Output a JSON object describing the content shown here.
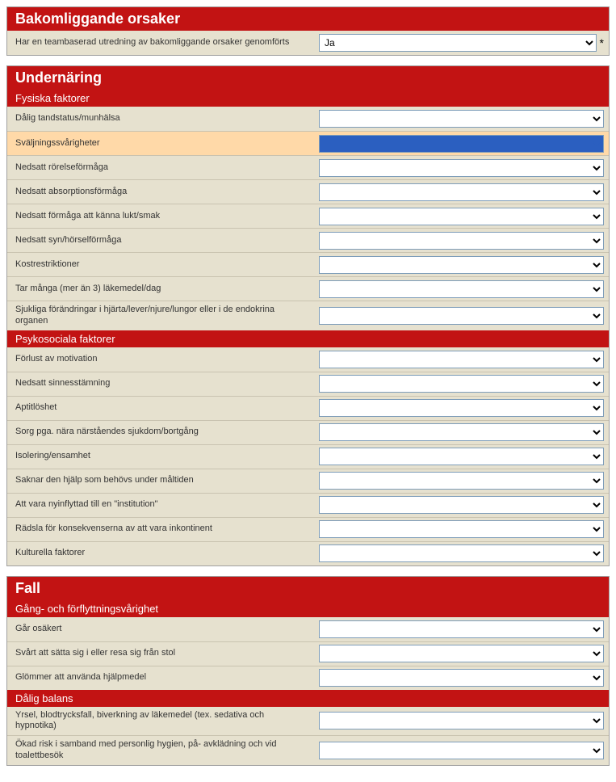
{
  "section1": {
    "title": "Bakomliggande orsaker",
    "rows": [
      {
        "label": "Har en teambaserad utredning av bakomliggande orsaker genomförts",
        "value": "Ja",
        "required": true
      }
    ]
  },
  "section2": {
    "title": "Undernäring",
    "sub1": {
      "title": "Fysiska faktorer",
      "rows": [
        {
          "label": "Dålig tandstatus/munhälsa",
          "value": "",
          "hl": false
        },
        {
          "label": "Sväljningssvårigheter",
          "value": "",
          "hl": true
        },
        {
          "label": "Nedsatt rörelseförmåga",
          "value": "",
          "hl": false
        },
        {
          "label": "Nedsatt absorptionsförmåga",
          "value": "",
          "hl": false
        },
        {
          "label": "Nedsatt förmåga att känna lukt/smak",
          "value": "",
          "hl": false
        },
        {
          "label": "Nedsatt syn/hörselförmåga",
          "value": "",
          "hl": false
        },
        {
          "label": "Kostrestriktioner",
          "value": "",
          "hl": false
        },
        {
          "label": "Tar många (mer än 3) läkemedel/dag",
          "value": "",
          "hl": false
        },
        {
          "label": "Sjukliga förändringar i hjärta/lever/njure/lungor eller i de endokrina organen",
          "value": "",
          "hl": false
        }
      ]
    },
    "sub2": {
      "title": "Psykosociala faktorer",
      "rows": [
        {
          "label": "Förlust av motivation",
          "value": ""
        },
        {
          "label": "Nedsatt sinnesstämning",
          "value": ""
        },
        {
          "label": "Aptitlöshet",
          "value": ""
        },
        {
          "label": "Sorg pga. nära närståendes sjukdom/bortgång",
          "value": ""
        },
        {
          "label": "Isolering/ensamhet",
          "value": ""
        },
        {
          "label": "Saknar den hjälp som behövs under måltiden",
          "value": ""
        },
        {
          "label": "Att vara nyinflyttad till en \"institution\"",
          "value": ""
        },
        {
          "label": "Rädsla för konsekvenserna av att vara inkontinent",
          "value": ""
        },
        {
          "label": "Kulturella faktorer",
          "value": ""
        }
      ]
    }
  },
  "section3": {
    "title": "Fall",
    "sub1": {
      "title": "Gång- och förflyttningsvårighet",
      "rows": [
        {
          "label": "Går osäkert",
          "value": ""
        },
        {
          "label": "Svårt att sätta sig i eller resa sig från stol",
          "value": ""
        },
        {
          "label": "Glömmer att använda hjälpmedel",
          "value": ""
        }
      ]
    },
    "sub2": {
      "title": "Dålig balans",
      "rows": [
        {
          "label": "Yrsel, blodtrycksfall, biverkning av läkemedel (tex. sedativa och hypnotika)",
          "value": ""
        },
        {
          "label": "Ökad risk i samband med personlig hygien, på- avklädning och vid toalettbesök",
          "value": ""
        }
      ]
    }
  },
  "required_marker": "*"
}
